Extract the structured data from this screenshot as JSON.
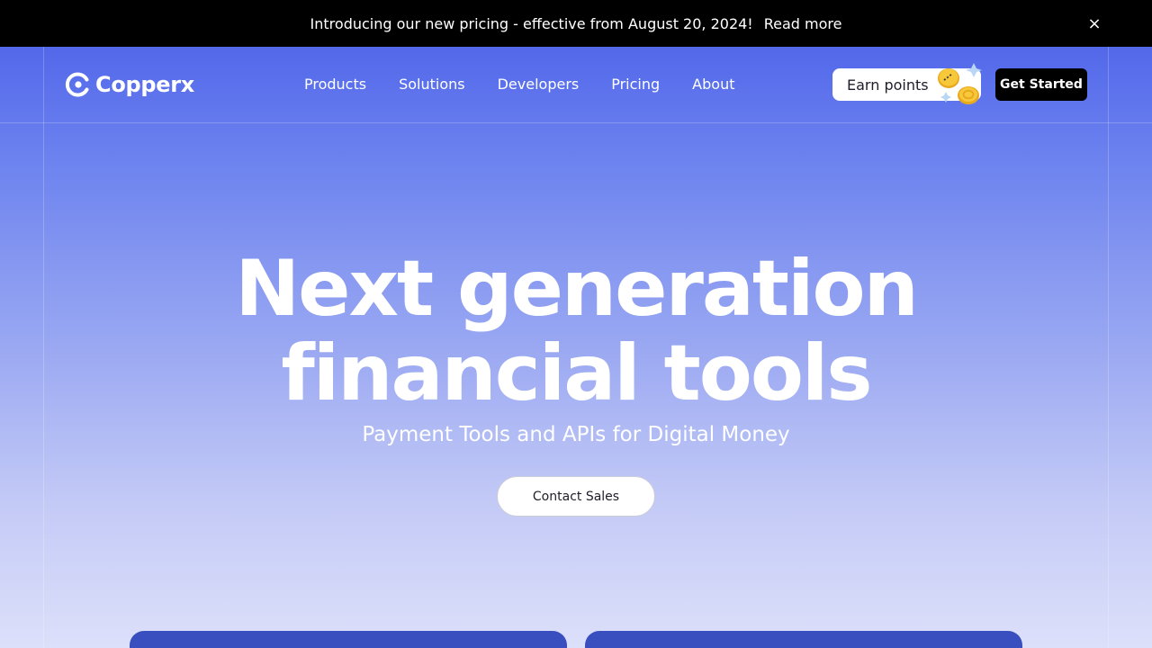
{
  "announcement": {
    "text": "Introducing our new pricing - effective from August 20, 2024!",
    "link_label": "Read more",
    "close_icon": "×"
  },
  "brand": {
    "name": "Copperx",
    "icon": "copperx-logo-icon"
  },
  "nav": {
    "items": [
      {
        "label": "Products"
      },
      {
        "label": "Solutions"
      },
      {
        "label": "Developers"
      },
      {
        "label": "Pricing"
      },
      {
        "label": "About"
      }
    ],
    "earn_points_label": "Earn points",
    "get_started_label": "Get Started"
  },
  "hero": {
    "headline_line1": "Next generation",
    "headline_line2": "financial tools",
    "subheadline": "Payment Tools and APIs for Digital Money",
    "cta_label": "Contact Sales"
  },
  "colors": {
    "announcement_bg": "#000000",
    "hero_top": "#5368ea",
    "hero_bottom": "#dde0fa",
    "card": "#3a4fbf",
    "coin": "#f7c83a"
  }
}
